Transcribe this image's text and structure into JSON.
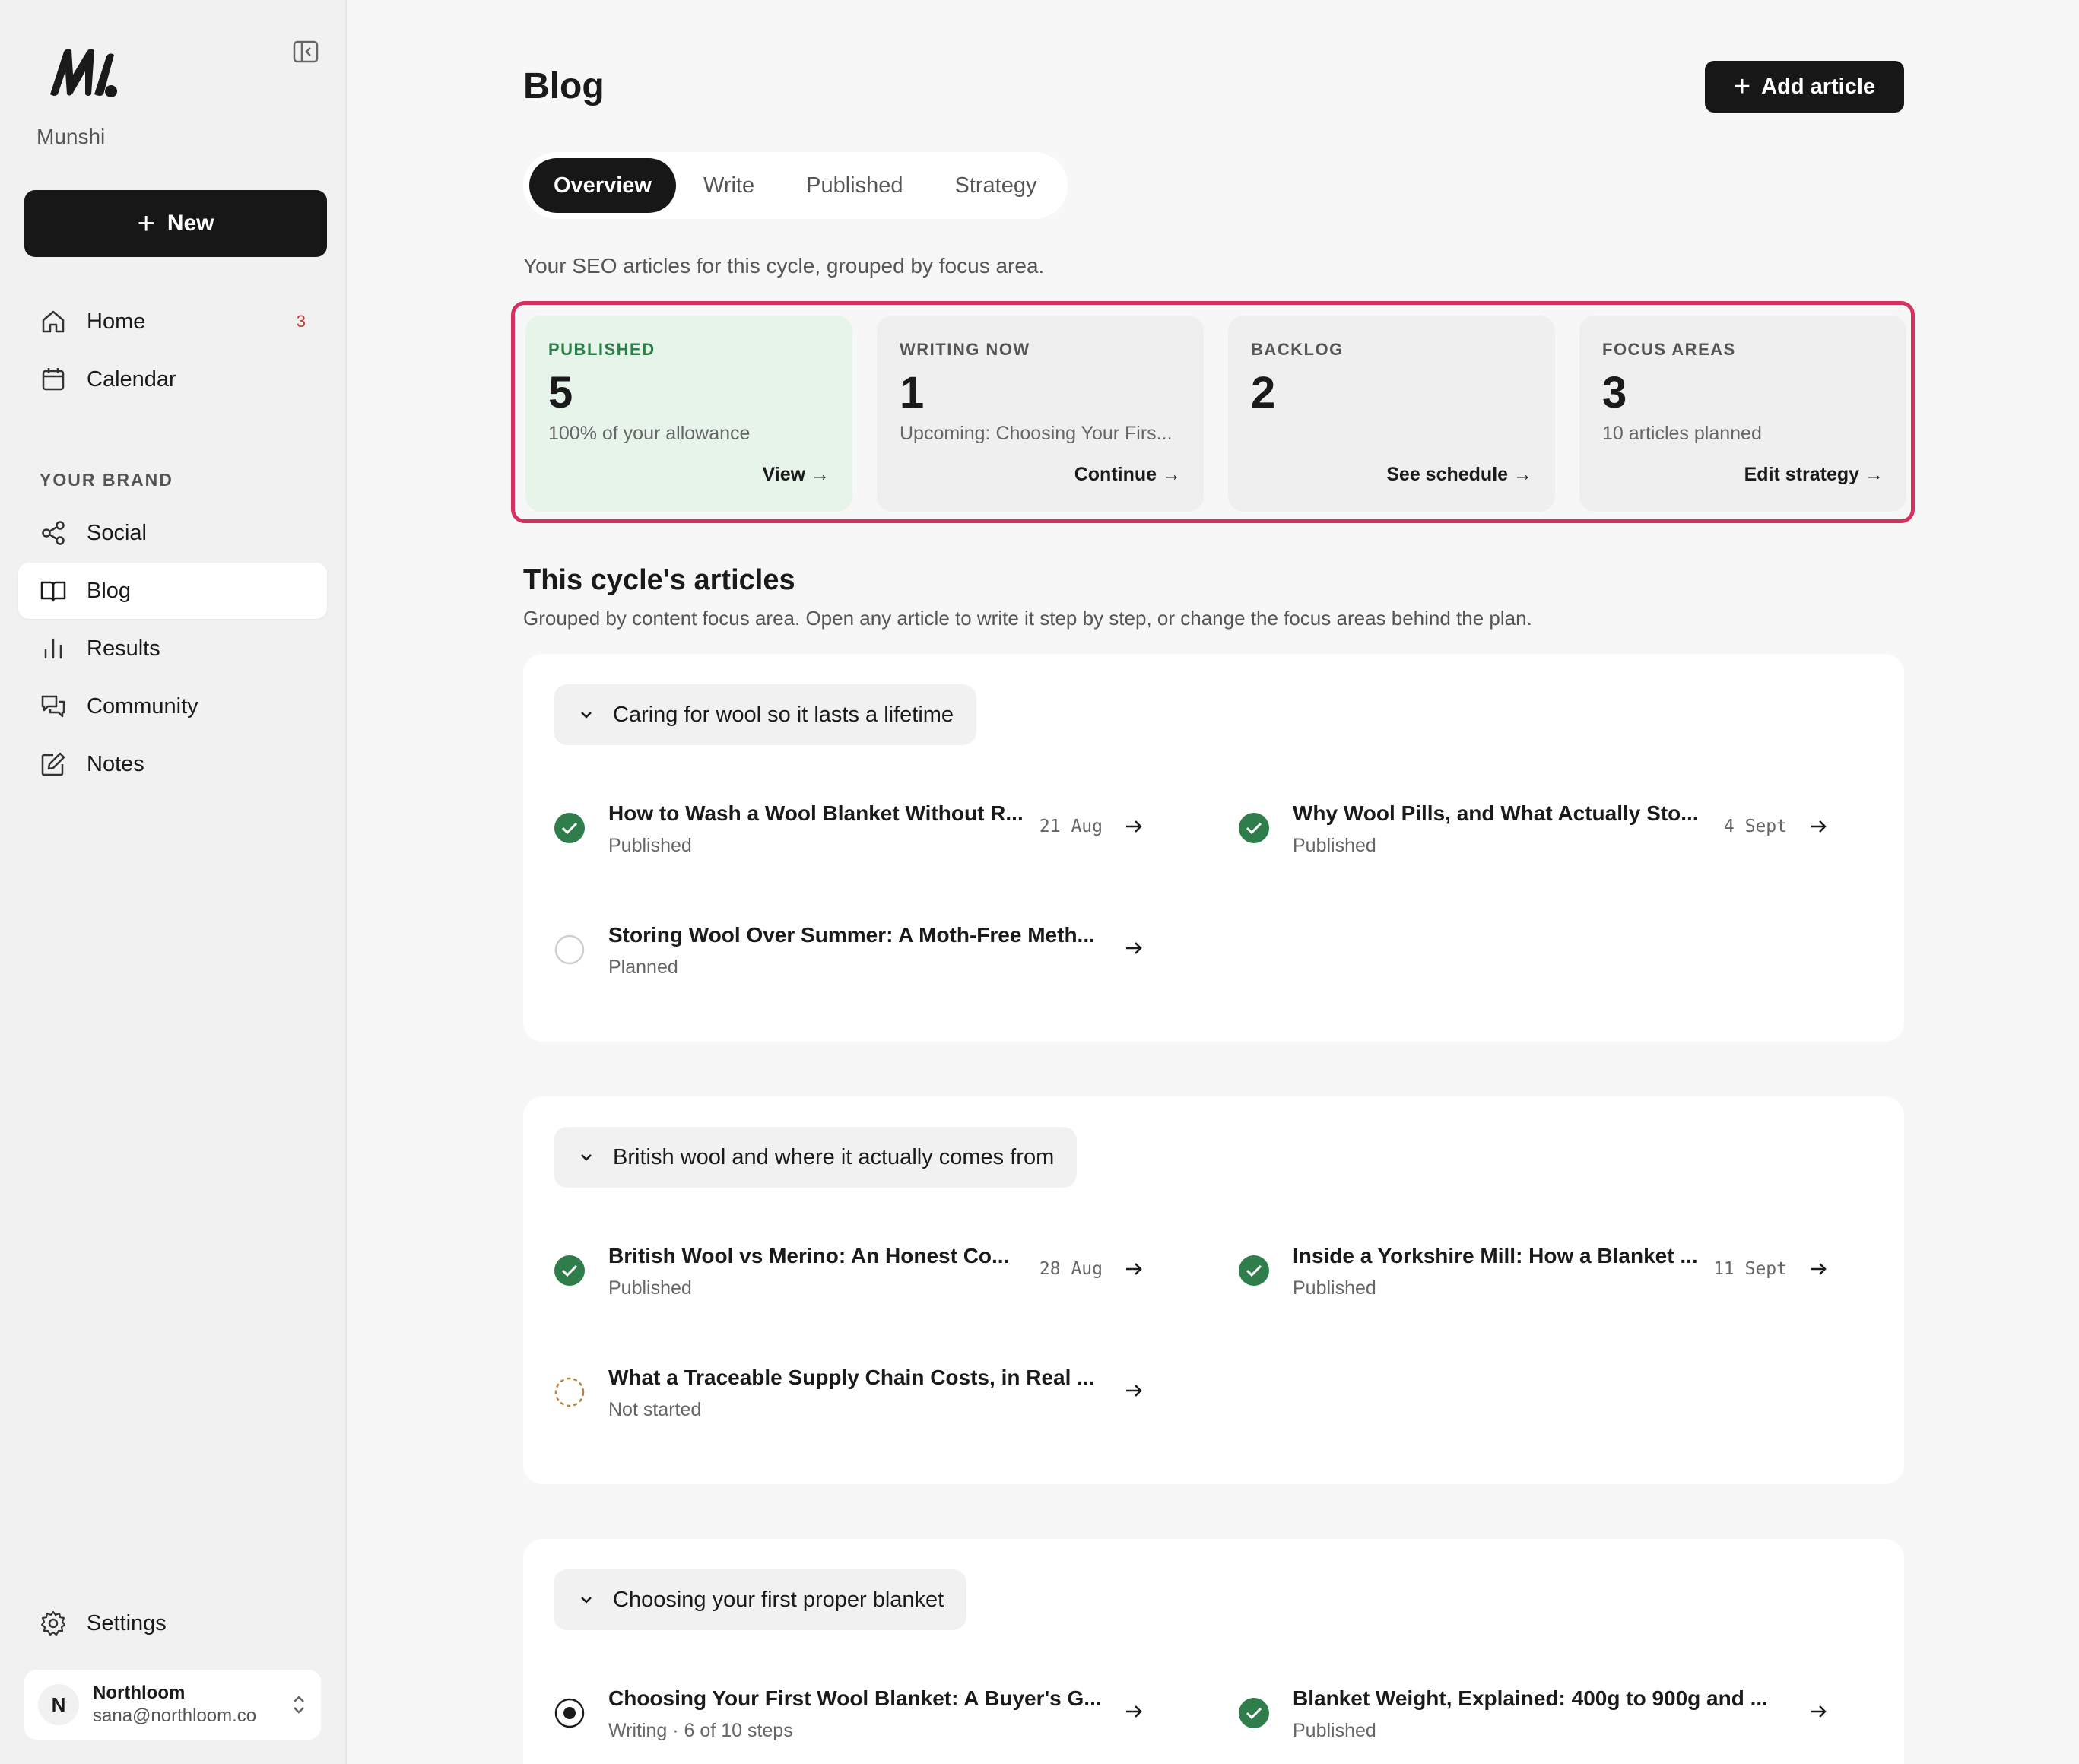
{
  "sidebar": {
    "brand": "Munshi",
    "new_label": "New",
    "nav": [
      {
        "label": "Home",
        "badge": "3",
        "icon": "home-icon"
      },
      {
        "label": "Calendar",
        "icon": "calendar-icon"
      }
    ],
    "section_label": "YOUR BRAND",
    "brand_nav": [
      {
        "label": "Social",
        "icon": "share-icon"
      },
      {
        "label": "Blog",
        "icon": "book-icon",
        "active": true
      },
      {
        "label": "Results",
        "icon": "bar-chart-icon"
      },
      {
        "label": "Community",
        "icon": "chat-icon"
      },
      {
        "label": "Notes",
        "icon": "edit-icon"
      }
    ],
    "settings_label": "Settings",
    "account": {
      "initial": "N",
      "name": "Northloom",
      "email": "sana@northloom.co"
    }
  },
  "header": {
    "title": "Blog",
    "add_label": "Add article"
  },
  "tabs": [
    "Overview",
    "Write",
    "Published",
    "Strategy"
  ],
  "active_tab": "Overview",
  "subtitle": "Your SEO articles for this cycle, grouped by focus area.",
  "stats": [
    {
      "label": "PUBLISHED",
      "value": "5",
      "desc": "100% of your allowance",
      "link": "View →"
    },
    {
      "label": "WRITING NOW",
      "value": "1",
      "desc": "Upcoming: Choosing Your Firs...",
      "link": "Continue →"
    },
    {
      "label": "BACKLOG",
      "value": "2",
      "desc": "",
      "link": "See schedule →"
    },
    {
      "label": "FOCUS AREAS",
      "value": "3",
      "desc": "10 articles planned",
      "link": "Edit strategy →"
    }
  ],
  "articles_section": {
    "title": "This cycle's articles",
    "subtitle": "Grouped by content focus area. Open any article to write it step by step, or change the focus areas behind the plan."
  },
  "groups": [
    {
      "title": "Caring for wool so it lasts a lifetime",
      "articles": [
        {
          "title": "How to Wash a Wool Blanket Without R...",
          "state": "Published",
          "date": "21 Aug",
          "status": "published"
        },
        {
          "title": "Why Wool Pills, and What Actually Sto...",
          "state": "Published",
          "date": "4 Sept",
          "status": "published"
        },
        {
          "title": "Storing Wool Over Summer: A Moth-Free Meth...",
          "state": "Planned",
          "date": "",
          "status": "planned"
        }
      ]
    },
    {
      "title": "British wool and where it actually comes from",
      "articles": [
        {
          "title": "British Wool vs Merino: An Honest Co...",
          "state": "Published",
          "date": "28 Aug",
          "status": "published"
        },
        {
          "title": "Inside a Yorkshire Mill: How a Blanket ...",
          "state": "Published",
          "date": "11 Sept",
          "status": "published"
        },
        {
          "title": "What a Traceable Supply Chain Costs, in Real ...",
          "state": "Not started",
          "date": "",
          "status": "not-started"
        }
      ]
    },
    {
      "title": "Choosing your first proper blanket",
      "articles": [
        {
          "title": "Choosing Your First Wool Blanket: A Buyer's G...",
          "state": "Writing · 6 of 10 steps",
          "date": "",
          "status": "writing"
        },
        {
          "title": "Blanket Weight, Explained: 400g to 900g and ...",
          "state": "Published",
          "date": "",
          "status": "published"
        }
      ]
    }
  ],
  "colors": {
    "accent": "#171717",
    "published_green": "#2e7d4a",
    "highlight": "#d6305e",
    "not_started": "#b8863b"
  }
}
